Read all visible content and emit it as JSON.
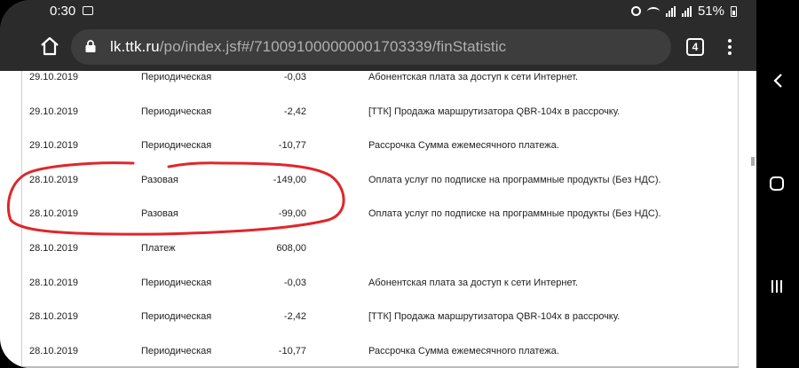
{
  "status_bar": {
    "time": "0:30",
    "battery": "51%"
  },
  "browser": {
    "url_host": "lk.ttk.ru",
    "url_path": "/po/index.jsf#/710091000000001703339/finStatistic",
    "tab_count": "4"
  },
  "annotation": {
    "color": "#e0262a"
  },
  "rows": [
    {
      "date": "29.10.2019",
      "type": "Периодическая",
      "amount": "-0,03",
      "description": "Абонентская плата за доступ к сети Интернет."
    },
    {
      "date": "29.10.2019",
      "type": "Периодическая",
      "amount": "-2,42",
      "description": "[ТТК] Продажа маршрутизатора QBR-104x в рассрочку."
    },
    {
      "date": "29.10.2019",
      "type": "Периодическая",
      "amount": "-10,77",
      "description": "Рассрочка Сумма ежемесячного платежа."
    },
    {
      "date": "28.10.2019",
      "type": "Разовая",
      "amount": "-149,00",
      "description": "Оплата услуг по подписке на программные продукты (Без НДС)."
    },
    {
      "date": "28.10.2019",
      "type": "Разовая",
      "amount": "-99,00",
      "description": "Оплата услуг по подписке на программные продукты (Без НДС)."
    },
    {
      "date": "28.10.2019",
      "type": "Платеж",
      "amount": "608,00",
      "description": ""
    },
    {
      "date": "28.10.2019",
      "type": "Периодическая",
      "amount": "-0,03",
      "description": "Абонентская плата за доступ к сети Интернет."
    },
    {
      "date": "28.10.2019",
      "type": "Периодическая",
      "amount": "-2,42",
      "description": "[ТТК] Продажа маршрутизатора QBR-104x в рассрочку."
    },
    {
      "date": "28.10.2019",
      "type": "Периодическая",
      "amount": "-10,77",
      "description": "Рассрочка Сумма ежемесячного платежа."
    }
  ]
}
